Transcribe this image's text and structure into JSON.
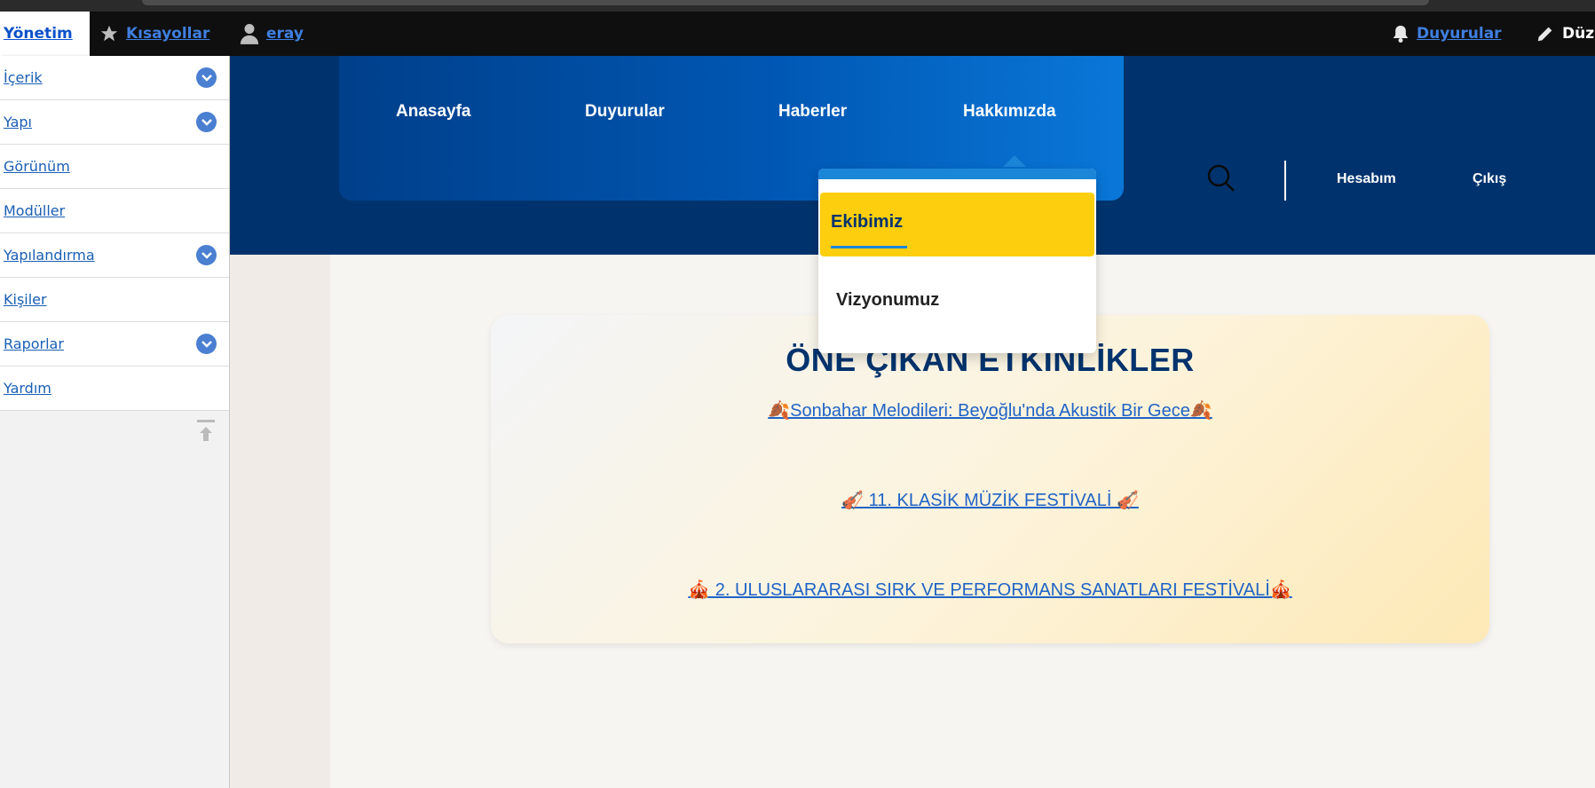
{
  "toolbar": {
    "yonetim": "Yönetim",
    "shortcuts": "Kısayollar",
    "user": "eray",
    "announcements": "Duyurular",
    "edit": "Düz",
    "icons": [
      "star-icon",
      "user-icon",
      "bell-icon",
      "pencil-icon"
    ]
  },
  "tray": {
    "items": [
      {
        "label": "İçerik",
        "has_toggle": true
      },
      {
        "label": "Yapı",
        "has_toggle": true
      },
      {
        "label": "Görünüm",
        "has_toggle": false
      },
      {
        "label": "Modüller",
        "has_toggle": false
      },
      {
        "label": "Yapılandırma",
        "has_toggle": true
      },
      {
        "label": "Kişiler",
        "has_toggle": false
      },
      {
        "label": "Raporlar",
        "has_toggle": true
      },
      {
        "label": "Yardım",
        "has_toggle": false
      }
    ]
  },
  "nav": {
    "items": [
      "Anasayfa",
      "Duyurular",
      "Haberler",
      "Hakkımızda"
    ],
    "account": "Hesabım",
    "logout": "Çıkış"
  },
  "dropdown": {
    "active_item": "Ekibimiz",
    "item": "Vizyonumuz"
  },
  "events": {
    "title": "ÖNE ÇIKAN ETKİNLİKLER",
    "links": [
      "🍂Sonbahar Melodileri: Beyoğlu'nda Akustik Bir Gece🍂",
      "🎻 11. KLASİK MÜZİK FESTİVALİ 🎻",
      "🎪 2. ULUSLARARASI SIRK VE PERFORMANS SANATLARI FESTİVALİ🎪"
    ]
  },
  "colors": {
    "toolbar_bg": "#0f0f0f",
    "header_bg": "#00336d",
    "accent_yellow": "#fdce0e",
    "accent_blue": "#1b86d8",
    "link_blue": "#1f63c6"
  }
}
